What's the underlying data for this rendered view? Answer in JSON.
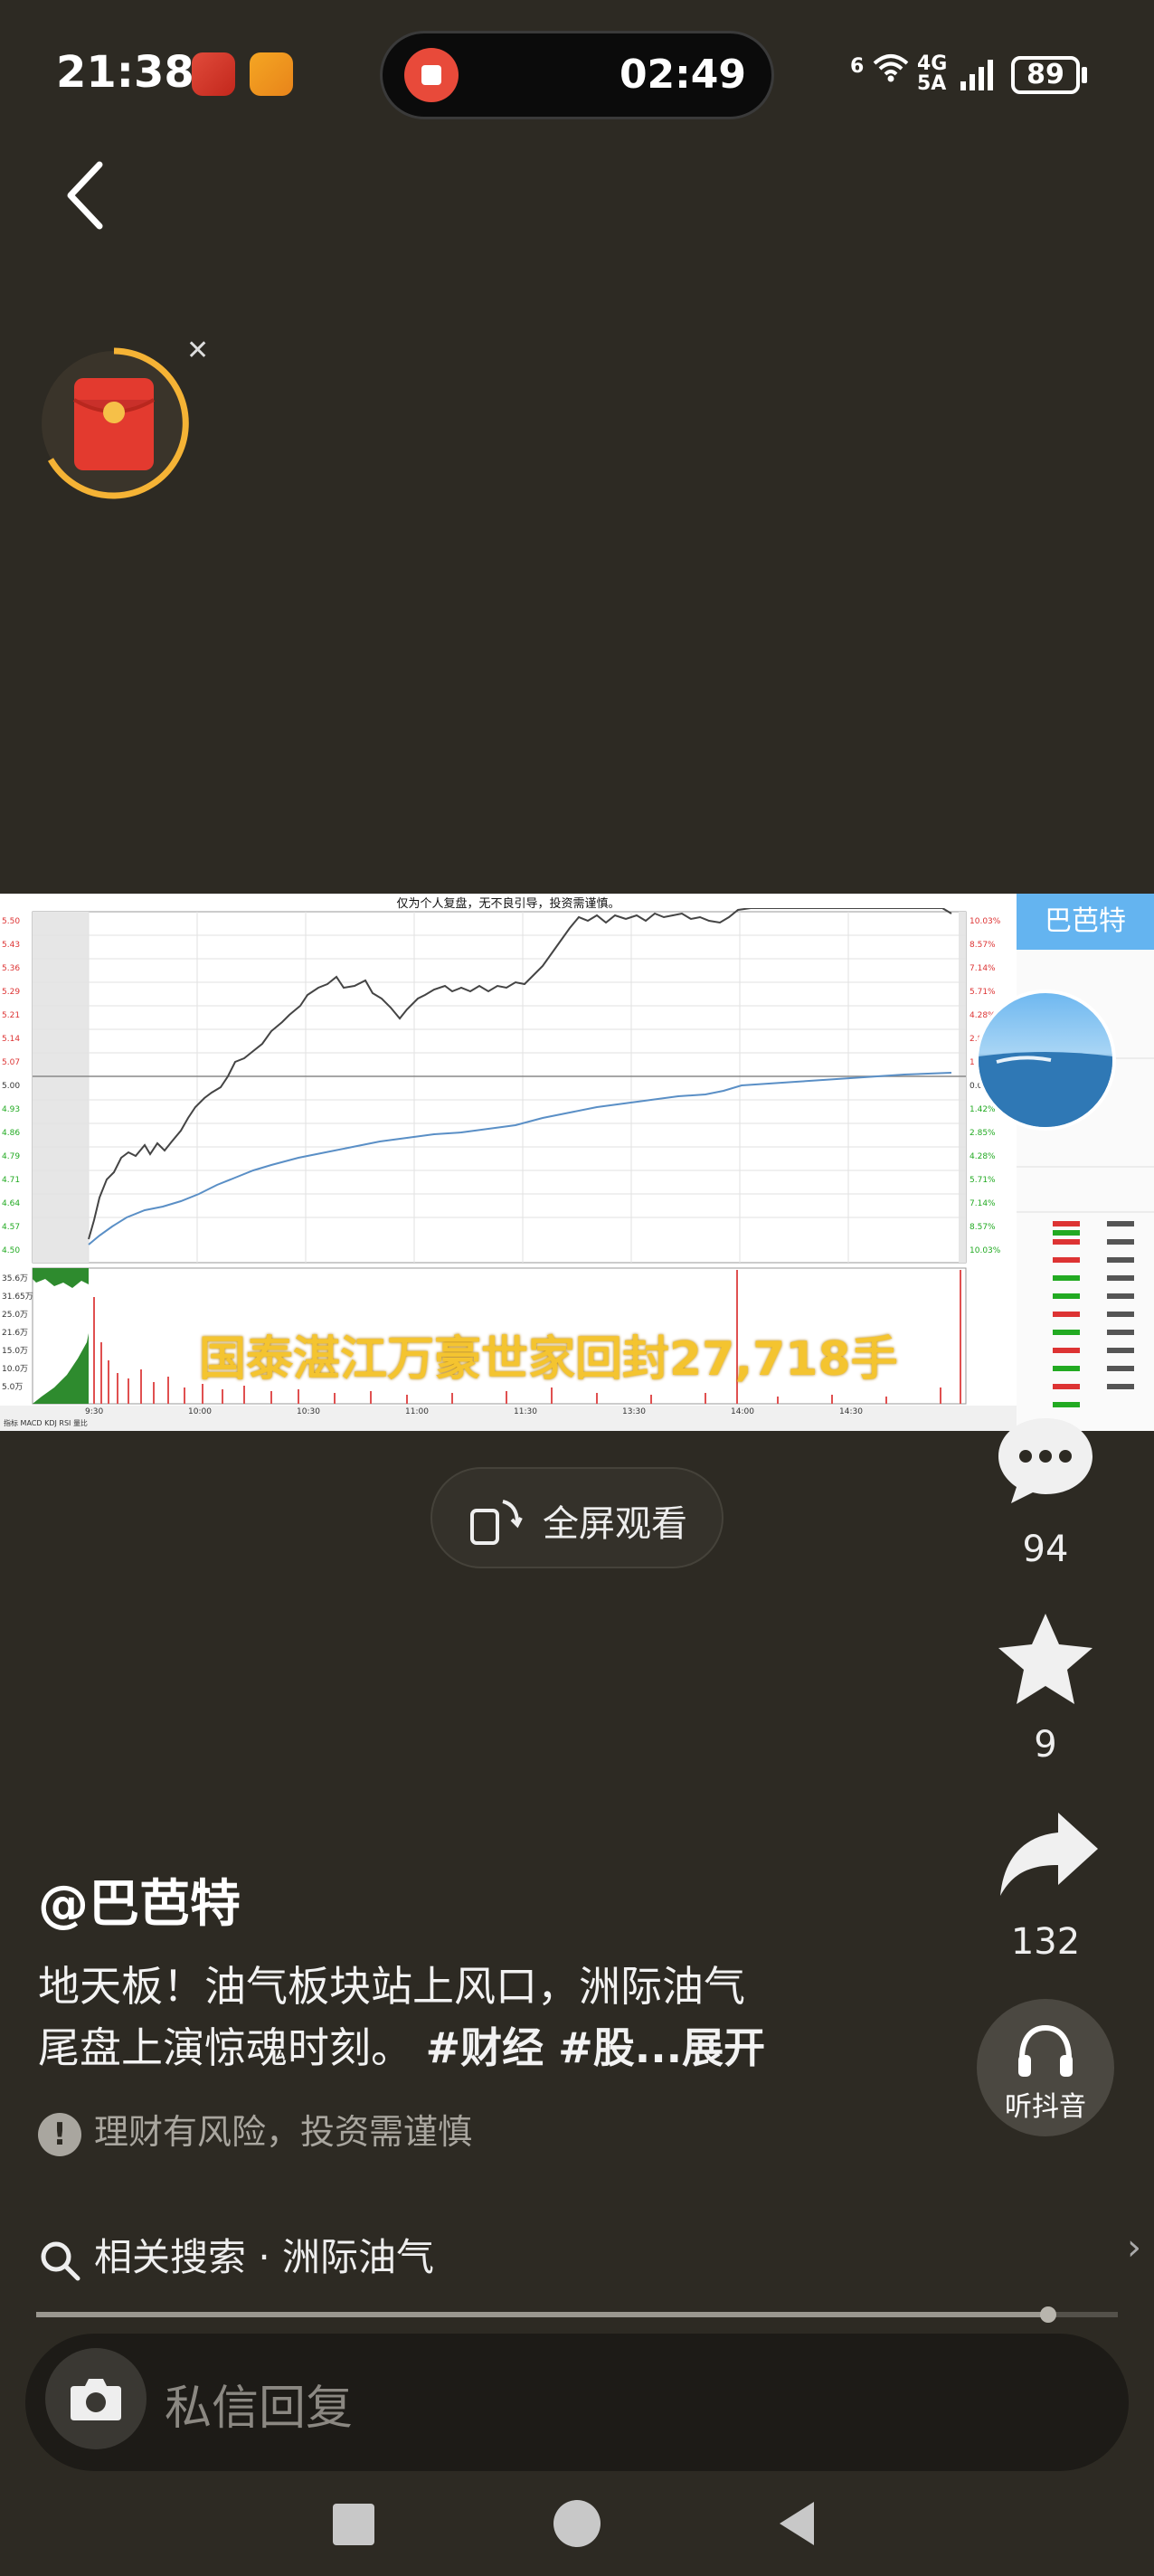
{
  "status_bar": {
    "time": "21:38",
    "recording_time": "02:49",
    "network_top": "6",
    "network_a": "4G",
    "network_b": "5A",
    "battery": "89"
  },
  "video": {
    "chart_title": "仅为个人复盘，无不良引导，投资需谨慎。",
    "side_name": "巴芭特",
    "overlay_text": "国泰湛江万豪世家回封27,718手",
    "y_prices": [
      "5.50",
      "5.43",
      "5.36",
      "5.29",
      "5.21",
      "5.14",
      "5.07",
      "5.00",
      "4.93",
      "4.86",
      "4.79",
      "4.71",
      "4.64",
      "4.57",
      "4.50"
    ],
    "y_pcts": [
      "10.03%",
      "8.57%",
      "7.14%",
      "5.71%",
      "4.28%",
      "2.85%",
      "1.42%",
      "0.00%",
      "1.42%",
      "2.85%",
      "4.28%",
      "5.71%",
      "7.14%",
      "8.57%",
      "10.03%"
    ],
    "x_times": [
      "9:30",
      "10:00",
      "10:30",
      "11:00",
      "11:30",
      "13:30",
      "14:00",
      "14:30"
    ],
    "vol_labels": [
      "35.6万",
      "31.65万",
      "25.0万",
      "21.6万",
      "15.0万",
      "10.0万",
      "5.0万"
    ],
    "tabs": [
      "指标",
      "MACD",
      "KDJ",
      "RSI",
      "量比"
    ]
  },
  "fullscreen": {
    "label": "全屏观看"
  },
  "actions": {
    "comments": "94",
    "favorites": "9",
    "shares": "132",
    "listen_label": "听抖音"
  },
  "caption": {
    "author": "@巴芭特",
    "line1": "地天板！油气板块站上风口，洲际油气",
    "line2_plain": "尾盘上演惊魂时刻。",
    "line2_tags": "#财经 #股...展开",
    "risk": "理财有风险，投资需谨慎"
  },
  "related": {
    "label": "相关搜索 · 洲际油气"
  },
  "reply": {
    "placeholder": "私信回复"
  },
  "colors": {
    "bg": "#2d2a23",
    "accent": "#f4c430",
    "record": "#e84a3a"
  }
}
